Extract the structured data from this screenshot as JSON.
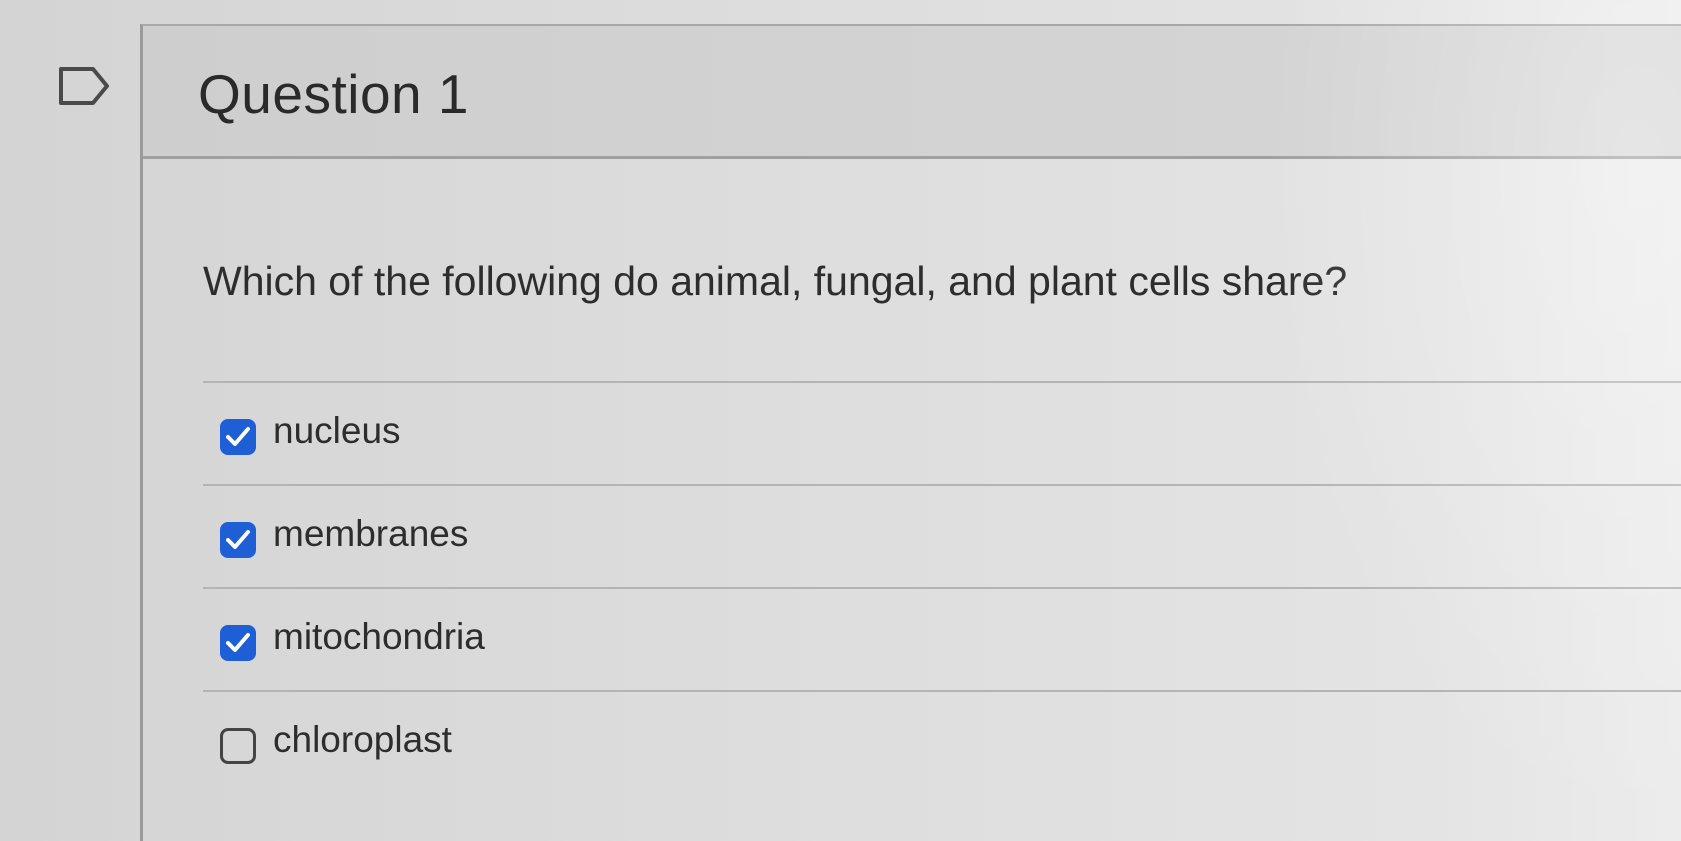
{
  "question": {
    "title": "Question 1",
    "prompt": "Which of the following do animal, fungal, and plant cells share?",
    "answers": [
      {
        "label": "nucleus",
        "checked": true
      },
      {
        "label": "membranes",
        "checked": true
      },
      {
        "label": "mitochondria",
        "checked": true
      },
      {
        "label": "chloroplast",
        "checked": false
      }
    ]
  },
  "icons": {
    "flag": "flag-icon",
    "check": "checkmark-icon"
  },
  "colors": {
    "checked_fill": "#1f5fd6",
    "text": "#2d2d2d"
  }
}
